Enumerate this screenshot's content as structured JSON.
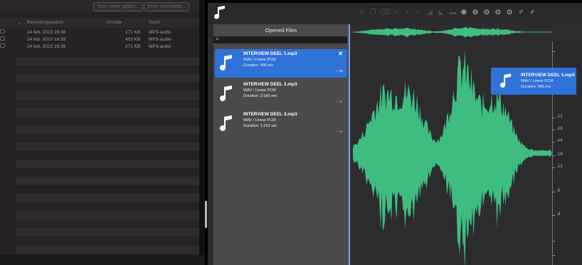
{
  "finder": {
    "toolbar_buttons": [
      "Toon meer opties...",
      "Meer informatie..."
    ],
    "columns": [
      "Bewerkingsdatum",
      "Grootte",
      "Soort"
    ],
    "rows": [
      {
        "date": "24 feb. 2023 16:38",
        "size": "171 KB",
        "kind": "MP3-audio"
      },
      {
        "date": "24 feb. 2023 16:39",
        "size": "453 KB",
        "kind": "MP3-audio"
      },
      {
        "date": "24 feb. 2023 16:39",
        "size": "271 KB",
        "kind": "MP3-audio"
      }
    ]
  },
  "editor": {
    "panel_title": "Opened Files",
    "files": [
      {
        "name": "INTERVIEW DEEL 1.mp3",
        "format": "WAV / Linear PCM",
        "duration": "Duration: 966 ms",
        "selected": true
      },
      {
        "name": "INTERVIEW DEEL 2.mp3",
        "format": "WAV / Linear PCM",
        "duration": "Duration: 2.566 sec",
        "selected": false
      },
      {
        "name": "INTERVIEW DEEL 3.mp3",
        "format": "WAV / Linear PCM",
        "duration": "Duration: 1.553 sec",
        "selected": false
      }
    ],
    "drag_item": {
      "name": "INTERVIEW DEEL 1.mp3",
      "format": "WAV / Linear PCM",
      "duration": "Duration: 966 ms"
    },
    "ruler_labels": [
      "-12",
      "-18",
      "-inf",
      "-18",
      "-12",
      "-6",
      "-3"
    ],
    "toolbar_icons": [
      "undo-icon",
      "copy-icon",
      "trash-icon",
      "crop-icon",
      "cursor-icon",
      "loop-icon",
      "fade-in-icon",
      "fade-out-icon",
      "silence-icon",
      "zoom-in-icon",
      "zoom-out-icon",
      "zoom-selection-icon",
      "zoom-fit-icon",
      "zoom-all-icon",
      "marker-icon",
      "marker-edit-icon"
    ],
    "colors": {
      "waveform": "#3fbd80",
      "selection": "#2f72d8"
    }
  }
}
